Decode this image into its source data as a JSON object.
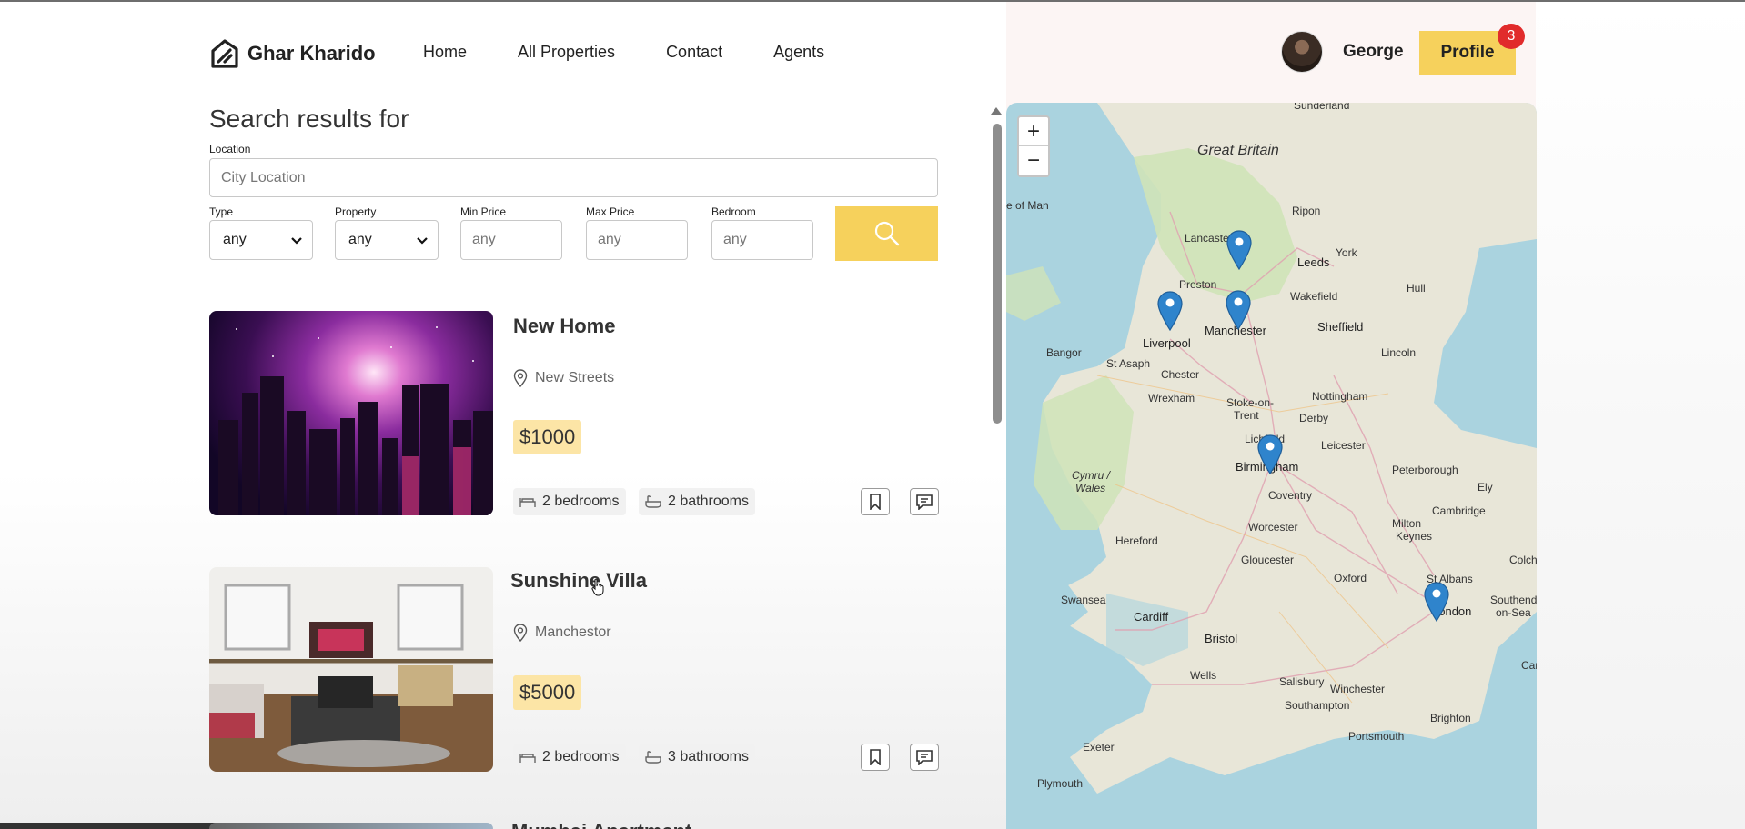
{
  "navbar": {
    "logo_text": "Ghar Kharido",
    "links": [
      "Home",
      "All Properties",
      "Contact",
      "Agents"
    ],
    "username": "George",
    "profile_label": "Profile",
    "notification_count": "3"
  },
  "search": {
    "title": "Search results for",
    "location_label": "Location",
    "location_placeholder": "City Location",
    "type_label": "Type",
    "type_value": "any",
    "property_label": "Property",
    "property_value": "any",
    "min_price_label": "Min Price",
    "min_price_placeholder": "any",
    "max_price_label": "Max Price",
    "max_price_placeholder": "any",
    "bedroom_label": "Bedroom",
    "bedroom_placeholder": "any"
  },
  "listings": [
    {
      "title": "New Home",
      "location": "New Streets",
      "price": "$1000",
      "bedrooms": "2 bedrooms",
      "bathrooms": "2 bathrooms"
    },
    {
      "title": "Sunshine Villa",
      "location": "Manchestor",
      "price": "$5000",
      "bedrooms": "2 bedrooms",
      "bathrooms": "3 bathrooms"
    },
    {
      "title": "Mumbai Apartment"
    }
  ],
  "map": {
    "zoom_in": "+",
    "zoom_out": "−",
    "labels": {
      "great_britain": "Great Britain",
      "isle_of_man": "e of Man",
      "sunderland": "Sunderland",
      "lancaster": "Lancaster",
      "ripon": "Ripon",
      "leeds": "Leeds",
      "york": "York",
      "preston": "Preston",
      "wakefield": "Wakefield",
      "hull": "Hull",
      "liverpool": "Liverpool",
      "manchester": "Manchester",
      "sheffield": "Sheffield",
      "bangor": "Bangor",
      "st_asaph": "St Asaph",
      "lincoln": "Lincoln",
      "chester": "Chester",
      "wrexham": "Wrexham",
      "stoke": "Stoke-on-",
      "trent": "Trent",
      "nottingham": "Nottingham",
      "derby": "Derby",
      "lichfield": "Lichfield",
      "leicester": "Leicester",
      "birmingham": "Birmingham",
      "peterborough": "Peterborough",
      "cymru": "Cymru /",
      "wales": "Wales",
      "coventry": "Coventry",
      "ely": "Ely",
      "cambridge": "Cambridge",
      "hereford": "Hereford",
      "worcester": "Worcester",
      "milton": "Milton",
      "keynes": "Keynes",
      "gloucester": "Gloucester",
      "oxford": "Oxford",
      "st_albans": "St Albans",
      "colche": "Colche",
      "swansea": "Swansea",
      "cardiff": "Cardiff",
      "london": "London",
      "southend": "Southend",
      "on_sea": "on-Sea",
      "bristol": "Bristol",
      "car": "Car",
      "wells": "Wells",
      "salisbury": "Salisbury",
      "winchester": "Winchester",
      "southampton": "Southampton",
      "brighton": "Brighton",
      "portsmouth": "Portsmouth",
      "exeter": "Exeter",
      "plymouth": "Plymouth"
    }
  }
}
